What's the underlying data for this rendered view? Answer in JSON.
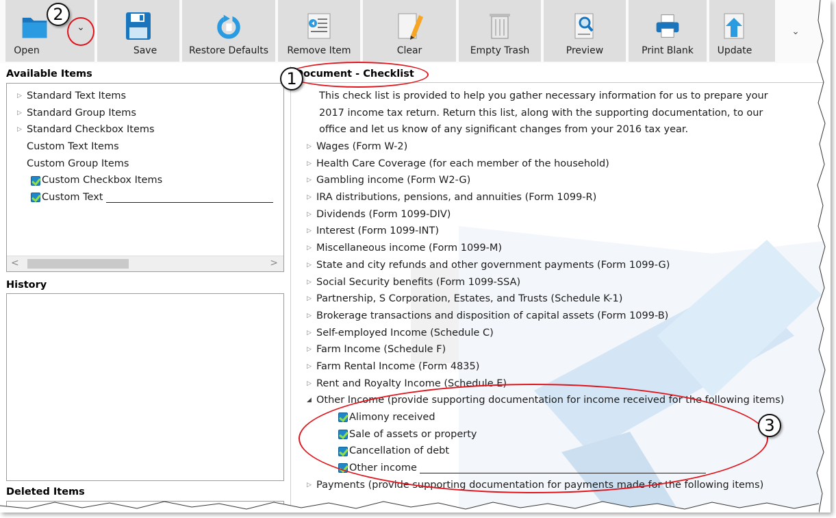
{
  "toolbar": {
    "open_label": "Open",
    "save_label": "Save",
    "restore_label": "Restore Defaults",
    "remove_label": "Remove Item",
    "clear_label": "Clear",
    "empty_trash_label": "Empty Trash",
    "preview_label": "Preview",
    "print_blank_label": "Print Blank",
    "update_label": "Update",
    "dropdown_glyph": "⌄"
  },
  "available_items": {
    "title": "Available Items",
    "items": [
      {
        "label": "Standard Text Items",
        "type": "collapsed"
      },
      {
        "label": "Standard Group Items",
        "type": "collapsed"
      },
      {
        "label": "Standard Checkbox Items",
        "type": "collapsed"
      },
      {
        "label": "Custom Text Items",
        "type": "leaf"
      },
      {
        "label": "Custom Group Items",
        "type": "leaf"
      },
      {
        "label": "Custom Checkbox Items",
        "type": "checked"
      },
      {
        "label": "Custom Text",
        "type": "checked-underline"
      }
    ]
  },
  "history": {
    "title": "History"
  },
  "deleted_items": {
    "title": "Deleted Items"
  },
  "document": {
    "title": "Document - Checklist",
    "intro": [
      "This check list is provided to help you gather necessary information for us to prepare your",
      "2017 income tax return.  Return this list, along with the supporting documentation, to our",
      "office and let us know of any significant changes from your 2016 tax year."
    ],
    "items": [
      "Wages (Form W-2)",
      "Health Care Coverage (for each member of the household)",
      "Gambling income (Form W2-G)",
      "IRA distributions, pensions, and annuities (Form 1099-R)",
      "Dividends (Form 1099-DIV)",
      "Interest (Form 1099-INT)",
      "Miscellaneous income (Form 1099-M)",
      "State and city refunds and other government payments (Form 1099-G)",
      "Social Security benefits (Form 1099-SSA)",
      "Partnership, S Corporation, Estates, and Trusts (Schedule K-1)",
      "Brokerage transactions and disposition of capital assets (Form 1099-B)",
      "Self-employed Income (Schedule C)",
      "Farm Income (Schedule F)",
      "Farm Rental Income (Form 4835)",
      "Rent and Royalty Income (Schedule E)"
    ],
    "other_income": {
      "label": "Other Income (provide supporting documentation for income received for the following items)",
      "children": [
        "Alimony received",
        "Sale of assets or property",
        "Cancellation of debt",
        "Other income"
      ]
    },
    "payments_label": "Payments (provide supporting documentation for payments made for the following items)"
  },
  "callouts": {
    "one": "1",
    "two": "2",
    "three": "3"
  },
  "colors": {
    "highlight_ring": "#e0141b",
    "checkbox": "#1f87c8",
    "toolbar_button": "#dedede"
  }
}
